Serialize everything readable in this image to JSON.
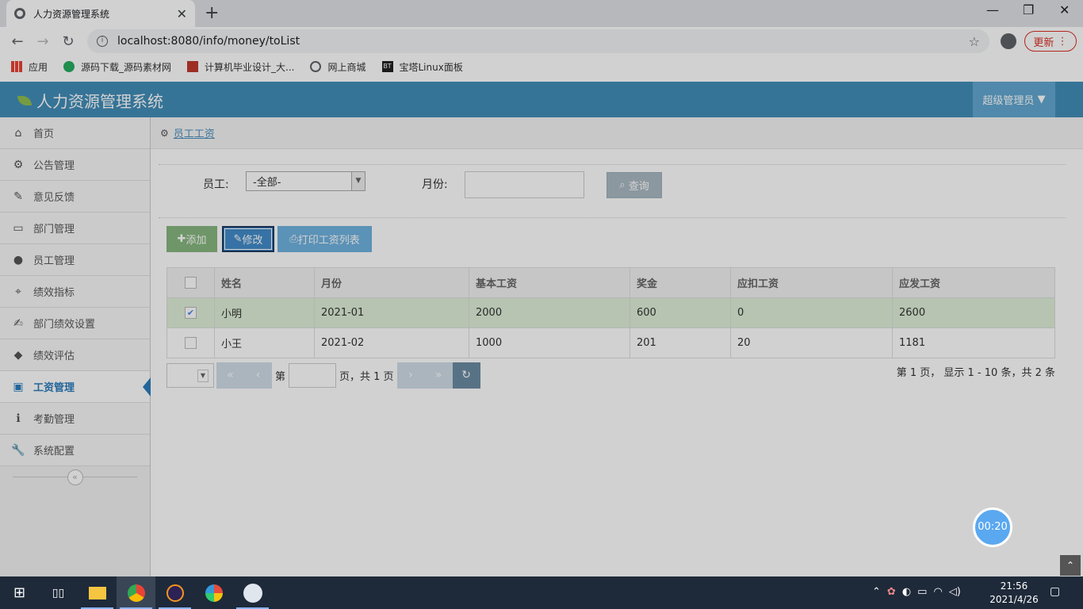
{
  "browser": {
    "tab_title": "人力资源管理系统",
    "url": "localhost:8080/info/money/toList",
    "update_label": "更新",
    "bookmarks": [
      {
        "label": "应用",
        "icon": "apps-grid-icon",
        "color": "#e94235"
      },
      {
        "label": "源码下载_源码素材网",
        "icon": "site-icon",
        "color": "#27ae60"
      },
      {
        "label": "计算机毕业设计_大...",
        "icon": "bi-icon",
        "color": "#c0392b"
      },
      {
        "label": "网上商城",
        "icon": "globe-icon",
        "color": "#5f6368"
      },
      {
        "label": "宝塔Linux面板",
        "icon": "bt-icon",
        "color": "#222222"
      }
    ]
  },
  "app": {
    "title": "人力资源管理系统",
    "user": "超级管理员",
    "colors": {
      "header": "#438eb9",
      "user_box": "#62a8d1",
      "add": "#87b87f",
      "edit": "#428bca",
      "print": "#6fb3e0",
      "query": "#abbac3",
      "selected_row": "#dff0d8"
    }
  },
  "sidebar": {
    "items": [
      {
        "label": "首页",
        "icon": "home-icon"
      },
      {
        "label": "公告管理",
        "icon": "gear-icon"
      },
      {
        "label": "意见反馈",
        "icon": "pencil-icon"
      },
      {
        "label": "部门管理",
        "icon": "desktop-icon"
      },
      {
        "label": "员工管理",
        "icon": "user-icon"
      },
      {
        "label": "绩效指标",
        "icon": "crosshair-icon"
      },
      {
        "label": "部门绩效设置",
        "icon": "edit-icon"
      },
      {
        "label": "绩效评估",
        "icon": "tag-icon"
      },
      {
        "label": "工资管理",
        "icon": "briefcase-icon",
        "active": true
      },
      {
        "label": "考勤管理",
        "icon": "info-icon"
      },
      {
        "label": "系统配置",
        "icon": "wrench-icon"
      }
    ]
  },
  "breadcrumb": {
    "label": "员工工资"
  },
  "filters": {
    "employee_label": "员工:",
    "employee_value": "-全部-",
    "month_label": "月份:",
    "month_value": "",
    "query_label": "查询"
  },
  "toolbar": {
    "add_label": "添加",
    "edit_label": "修改",
    "print_label": "打印工资列表"
  },
  "table": {
    "columns": [
      "姓名",
      "月份",
      "基本工资",
      "奖金",
      "应扣工资",
      "应发工资"
    ],
    "rows": [
      {
        "cells": [
          "小明",
          "2021-01",
          "2000",
          "600",
          "0",
          "2600"
        ],
        "checked": true
      },
      {
        "cells": [
          "小王",
          "2021-02",
          "1000",
          "201",
          "20",
          "1181"
        ],
        "checked": false
      }
    ]
  },
  "pager": {
    "page_prefix": "第",
    "page_value": "",
    "page_suffix": "页，共 1 页",
    "info": "第 1 页， 显示 1 - 10 条，共 2 条"
  },
  "timer": "00:20",
  "taskbar": {
    "time": "21:56",
    "date": "2021/4/26"
  }
}
